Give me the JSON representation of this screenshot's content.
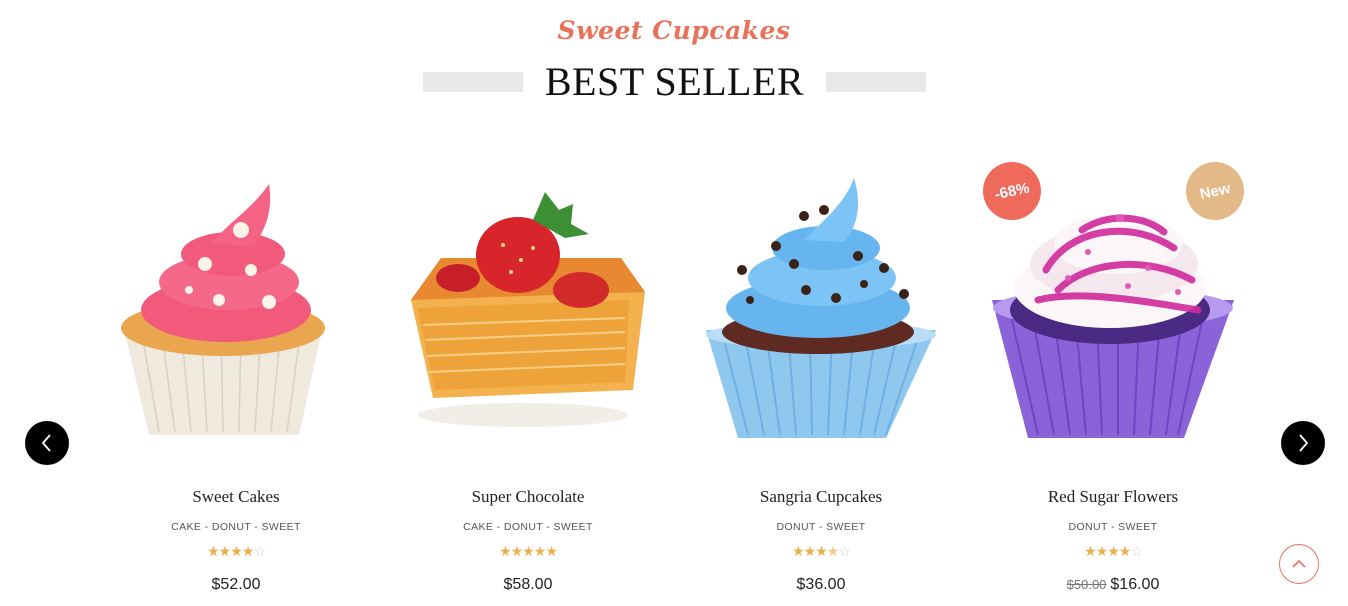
{
  "header": {
    "kicker": "Sweet Cupcakes",
    "title": "BEST SELLER"
  },
  "nav": {
    "prev_icon": "chevron-left-icon",
    "next_icon": "chevron-right-icon"
  },
  "colors": {
    "accent": "#e8735a",
    "star": "#e8b14c",
    "sale_badge": "#ef6a5b",
    "new_badge": "#e2b987"
  },
  "products": [
    {
      "name": "Sweet Cakes",
      "categories": "CAKE - DONUT - SWEET",
      "rating": 4,
      "rating_max": 5,
      "price": "$52.00",
      "old_price": ""
    },
    {
      "name": "Super Chocolate",
      "categories": "CAKE - DONUT - SWEET",
      "rating": 5,
      "rating_max": 5,
      "price": "$58.00",
      "old_price": ""
    },
    {
      "name": "Sangria Cupcakes",
      "categories": "DONUT - SWEET",
      "rating": 3.5,
      "rating_max": 5,
      "price": "$36.00",
      "old_price": ""
    },
    {
      "name": "Red Sugar Flowers",
      "categories": "DONUT - SWEET",
      "rating": 4,
      "rating_max": 5,
      "price": "$16.00",
      "old_price": "$50.00",
      "badges": {
        "sale": "-68%",
        "new": "New"
      }
    }
  ],
  "scroll_top_icon": "chevron-up-icon"
}
